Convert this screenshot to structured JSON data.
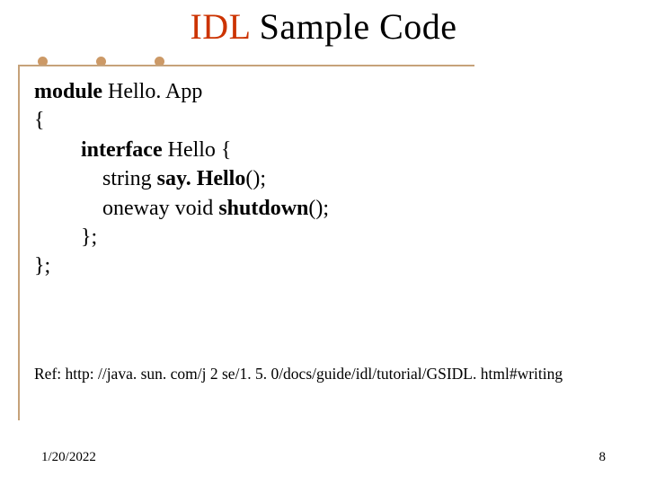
{
  "title": {
    "part1": "IDL",
    "part2": " Sample Code"
  },
  "code": {
    "l1_kw": "module",
    "l1_rest": " Hello. App",
    "l2": "{",
    "l3_kw": "interface",
    "l3_mid": " Hello {",
    "l4_a": "string ",
    "l4_kw": "say. Hello",
    "l4_b": "();",
    "l5_a": "oneway void ",
    "l5_kw": "shutdown",
    "l5_b": "();",
    "l6": "};",
    "l7": "};"
  },
  "ref": "Ref: http: //java. sun. com/j 2 se/1. 5. 0/docs/guide/idl/tutorial/GSIDL. html#writing",
  "footer": {
    "date": "1/20/2022",
    "page": "8"
  }
}
